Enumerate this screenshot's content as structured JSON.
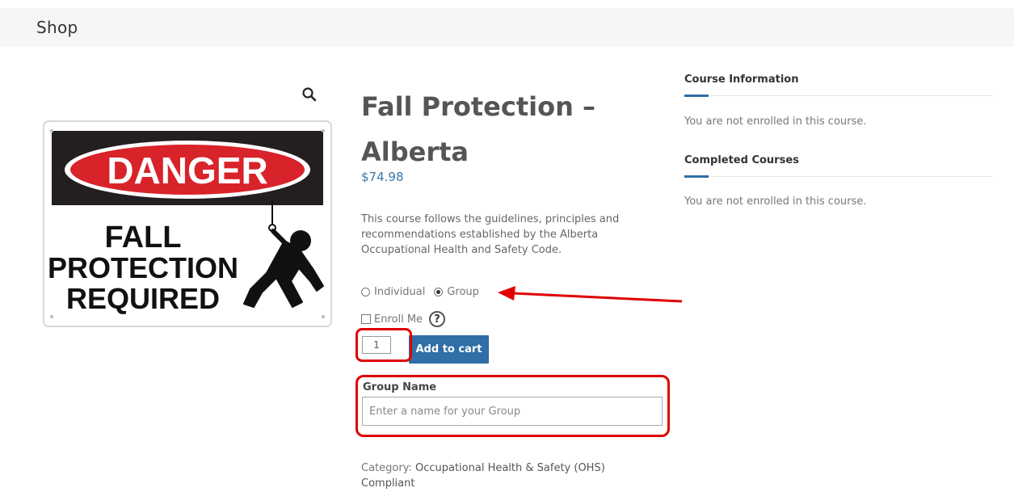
{
  "header": {
    "title": "Shop"
  },
  "product": {
    "title": "Fall Protection – Alberta",
    "price": "$74.98",
    "description": "This course follows the guidelines, principles and recommendations established by the Alberta Occupational Health and Safety Code.",
    "image": {
      "banner_text": "DANGER",
      "line1": "FALL",
      "line2": "PROTECTION",
      "line3": "REQUIRED"
    },
    "options": {
      "individual_label": "Individual",
      "group_label": "Group",
      "selected": "Group",
      "enroll_label": "Enroll Me",
      "help_symbol": "?"
    },
    "quantity": "1",
    "add_to_cart_label": "Add to cart",
    "group_name": {
      "label": "Group Name",
      "placeholder": "Enter a name for your Group"
    },
    "category": {
      "label": "Category:",
      "value": "Occupational Health & Safety (OHS) Compliant"
    }
  },
  "sidebar": {
    "course_info": {
      "heading": "Course Information",
      "text": "You are not enrolled in this course."
    },
    "completed": {
      "heading": "Completed Courses",
      "text": "You are not enrolled in this course."
    }
  },
  "icons": {
    "zoom": "magnifier-icon"
  },
  "colors": {
    "accent": "#2f6ea6",
    "price": "#3b76a9",
    "annotation": "#e00000",
    "danger_red": "#d8232a"
  }
}
